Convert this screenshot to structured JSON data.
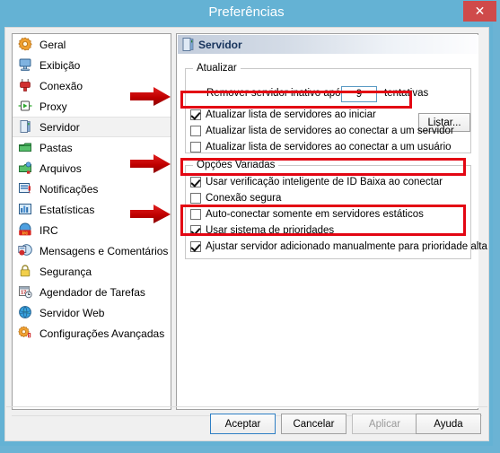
{
  "window": {
    "title": "Preferências",
    "close_label": "✕",
    "close_icon": "close-icon"
  },
  "sidebar": {
    "items": [
      {
        "label": "Geral",
        "icon": "gear-orange-icon",
        "selected": false
      },
      {
        "label": "Exibição",
        "icon": "monitor-icon",
        "selected": false
      },
      {
        "label": "Conexão",
        "icon": "plug-red-icon",
        "selected": false
      },
      {
        "label": "Proxy",
        "icon": "proxy-green-icon",
        "selected": false
      },
      {
        "label": "Servidor",
        "icon": "server-blue-icon",
        "selected": true
      },
      {
        "label": "Pastas",
        "icon": "folder-green-icon",
        "selected": false
      },
      {
        "label": "Arquivos",
        "icon": "files-green-icon",
        "selected": false
      },
      {
        "label": "Notificações",
        "icon": "notification-icon",
        "selected": false
      },
      {
        "label": "Estatísticas",
        "icon": "statistics-icon",
        "selected": false
      },
      {
        "label": "IRC",
        "icon": "irc-icon",
        "selected": false
      },
      {
        "label": "Mensagens e Comentários",
        "icon": "messages-icon",
        "selected": false
      },
      {
        "label": "Segurança",
        "icon": "lock-icon",
        "selected": false
      },
      {
        "label": "Agendador de Tarefas",
        "icon": "calendar-clock-icon",
        "selected": false
      },
      {
        "label": "Servidor Web",
        "icon": "globe-icon",
        "selected": false
      },
      {
        "label": "Configurações Avançadas",
        "icon": "advanced-settings-icon",
        "selected": false
      }
    ]
  },
  "panel": {
    "header_title": "Servidor",
    "header_icon": "server-blue-icon",
    "group_update": {
      "title": "Atualizar",
      "remove_label_before": "Remover servidor inativo após",
      "remove_value": "9",
      "remove_label_after": "tentativas",
      "list_button": "Listar...",
      "options": [
        {
          "label": "Atualizar lista de servidores ao iniciar",
          "checked": true,
          "highlighted": true
        },
        {
          "label": "Atualizar lista de servidores ao conectar a um servidor",
          "checked": false,
          "highlighted": false
        },
        {
          "label": "Atualizar lista de servidores ao conectar a um usuário",
          "checked": false,
          "highlighted": false
        }
      ]
    },
    "group_misc": {
      "title": "Opções Variadas",
      "options": [
        {
          "label": "Usar verificação inteligente de ID Baixa ao conectar",
          "checked": true,
          "highlighted": true
        },
        {
          "label": "Conexão segura",
          "checked": false,
          "highlighted": false
        },
        {
          "label": "Auto-conectar somente em servidores estáticos",
          "checked": false,
          "highlighted": false
        },
        {
          "label": "Usar sistema de prioridades",
          "checked": true,
          "highlighted": true
        },
        {
          "label": "Ajustar servidor adicionado manualmente para prioridade alta",
          "checked": true,
          "highlighted": true
        }
      ]
    }
  },
  "footer": {
    "buttons": [
      {
        "label": "Aceptar",
        "state": "default"
      },
      {
        "label": "Cancelar",
        "state": "normal"
      },
      {
        "label": "Aplicar",
        "state": "disabled"
      },
      {
        "label": "Ayuda",
        "state": "normal"
      }
    ]
  },
  "annotations": {
    "arrow_color": "#c00000",
    "highlight_color": "#e30613",
    "arrows": [
      {
        "name": "arrow-pointing-to-update-list-on-start"
      },
      {
        "name": "arrow-pointing-to-smart-lowid-check"
      },
      {
        "name": "arrow-pointing-to-priority-system"
      }
    ]
  }
}
